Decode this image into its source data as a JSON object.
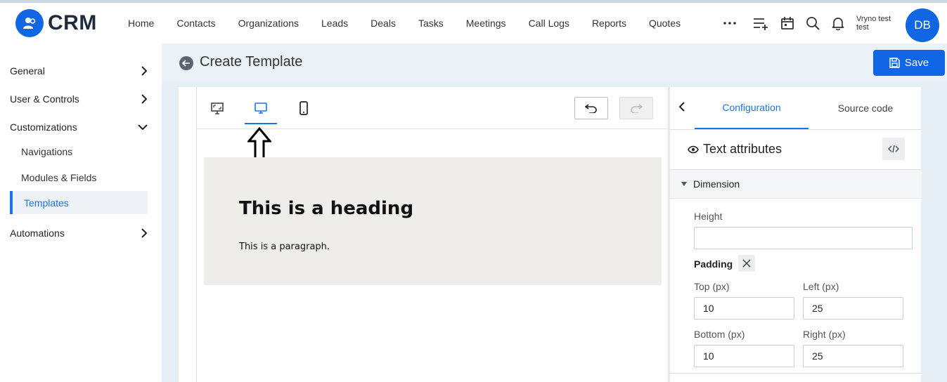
{
  "app": {
    "name": "CRM"
  },
  "nav": {
    "items": [
      "Home",
      "Contacts",
      "Organizations",
      "Leads",
      "Deals",
      "Tasks",
      "Meetings",
      "Call Logs",
      "Reports",
      "Quotes"
    ]
  },
  "header_icons": [
    "more-icon",
    "add-list-icon",
    "calendar-icon",
    "search-icon",
    "bell-icon"
  ],
  "user": {
    "name_line1": "Vryno test",
    "name_line2": "test",
    "initials": "DB"
  },
  "sidebar": {
    "general": "General",
    "user_controls": "User & Controls",
    "customizations": "Customizations",
    "navigations": "Navigations",
    "modules_fields": "Modules & Fields",
    "templates": "Templates",
    "automations": "Automations"
  },
  "page": {
    "title": "Create Template",
    "save_label": "Save"
  },
  "canvas": {
    "heading": "This is a heading",
    "paragraph": "This is a paragraph."
  },
  "panel": {
    "tab_configuration": "Configuration",
    "tab_source": "Source code",
    "section_title": "Text attributes",
    "dimension": "Dimension",
    "height_label": "Height",
    "height_value": "",
    "padding_label": "Padding",
    "top_label": "Top (px)",
    "top_value": "10",
    "left_label": "Left (px)",
    "left_value": "25",
    "bottom_label": "Bottom (px)",
    "bottom_value": "10",
    "right_label": "Right (px)",
    "right_value": "25"
  },
  "colors": {
    "accent": "#1167e3",
    "canvas_block": "#efede9"
  }
}
